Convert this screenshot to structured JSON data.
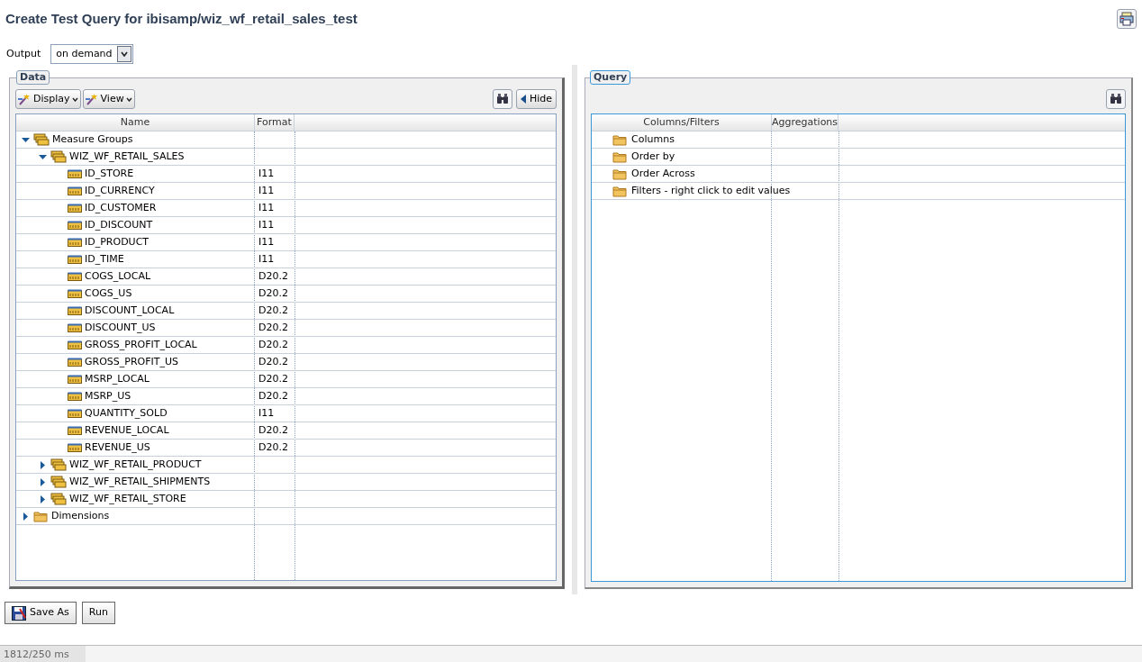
{
  "title": "Create Test Query for ibisamp/wiz_wf_retail_sales_test",
  "output": {
    "label": "Output",
    "value": "on demand"
  },
  "data_panel": {
    "legend": "Data",
    "toolbar": [
      "Display",
      "View"
    ],
    "hide_button": "Hide",
    "columns": [
      "Name",
      "Format"
    ],
    "tree": [
      {
        "kind": "group",
        "name": "Measure Groups",
        "expanded": true,
        "children": [
          {
            "kind": "group",
            "name": "WIZ_WF_RETAIL_SALES",
            "expanded": true,
            "children": [
              {
                "kind": "field",
                "name": "ID_STORE",
                "format": "I11"
              },
              {
                "kind": "field",
                "name": "ID_CURRENCY",
                "format": "I11"
              },
              {
                "kind": "field",
                "name": "ID_CUSTOMER",
                "format": "I11"
              },
              {
                "kind": "field",
                "name": "ID_DISCOUNT",
                "format": "I11"
              },
              {
                "kind": "field",
                "name": "ID_PRODUCT",
                "format": "I11"
              },
              {
                "kind": "field",
                "name": "ID_TIME",
                "format": "I11"
              },
              {
                "kind": "field",
                "name": "COGS_LOCAL",
                "format": "D20.2"
              },
              {
                "kind": "field",
                "name": "COGS_US",
                "format": "D20.2"
              },
              {
                "kind": "field",
                "name": "DISCOUNT_LOCAL",
                "format": "D20.2"
              },
              {
                "kind": "field",
                "name": "DISCOUNT_US",
                "format": "D20.2"
              },
              {
                "kind": "field",
                "name": "GROSS_PROFIT_LOCAL",
                "format": "D20.2"
              },
              {
                "kind": "field",
                "name": "GROSS_PROFIT_US",
                "format": "D20.2"
              },
              {
                "kind": "field",
                "name": "MSRP_LOCAL",
                "format": "D20.2"
              },
              {
                "kind": "field",
                "name": "MSRP_US",
                "format": "D20.2"
              },
              {
                "kind": "field",
                "name": "QUANTITY_SOLD",
                "format": "I11"
              },
              {
                "kind": "field",
                "name": "REVENUE_LOCAL",
                "format": "D20.2"
              },
              {
                "kind": "field",
                "name": "REVENUE_US",
                "format": "D20.2"
              }
            ]
          },
          {
            "kind": "group",
            "name": "WIZ_WF_RETAIL_PRODUCT",
            "expanded": false
          },
          {
            "kind": "group",
            "name": "WIZ_WF_RETAIL_SHIPMENTS",
            "expanded": false
          },
          {
            "kind": "group",
            "name": "WIZ_WF_RETAIL_STORE",
            "expanded": false
          }
        ]
      },
      {
        "kind": "folder",
        "name": "Dimensions",
        "expanded": false
      }
    ]
  },
  "query_panel": {
    "legend": "Query",
    "columns": [
      "Columns/Filters",
      "Aggregations"
    ],
    "rows": [
      "Columns",
      "Order by",
      "Order Across",
      "Filters - right click to edit values"
    ]
  },
  "buttons": [
    "Save As",
    "Run"
  ],
  "status_bar": "1812/250 ms"
}
